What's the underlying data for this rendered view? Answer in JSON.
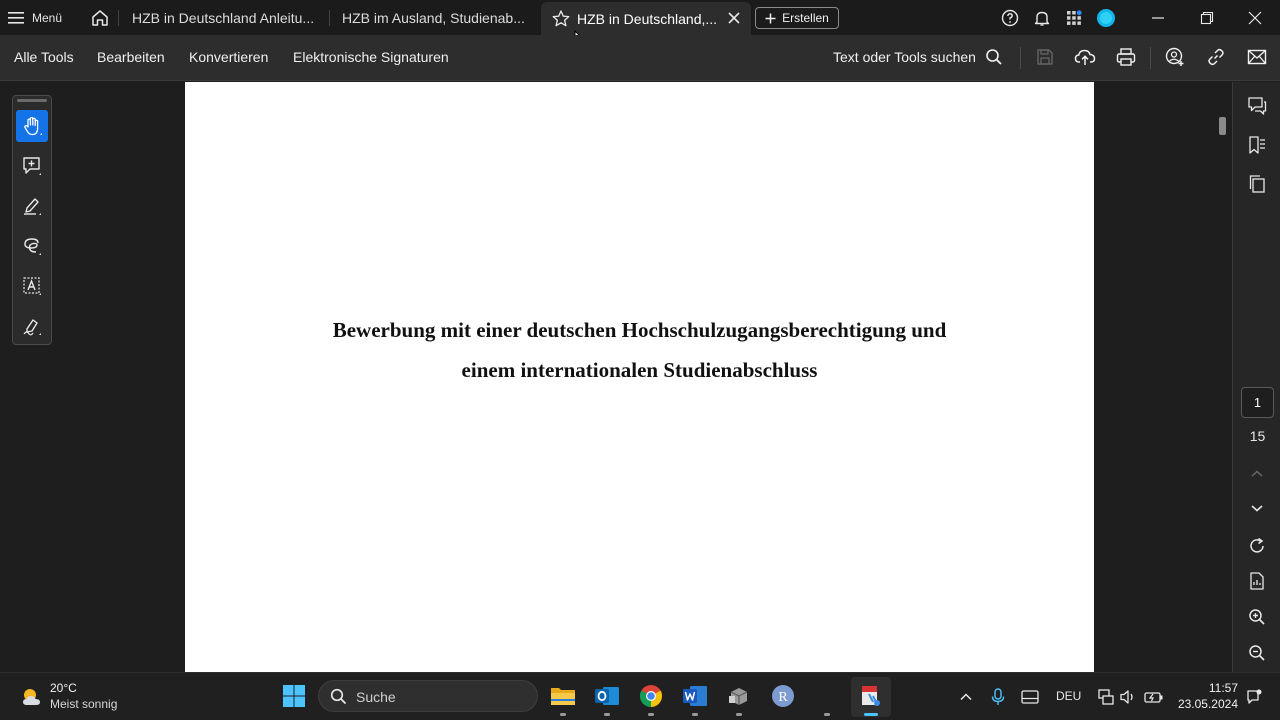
{
  "titlebar": {
    "menu_label": "Menü",
    "tabs": [
      {
        "label": "HZB in Deutschland Anleitu..."
      },
      {
        "label": "HZB im Ausland, Studienab..."
      },
      {
        "label": "HZB in Deutschland,..."
      }
    ],
    "create_label": "Erstellen"
  },
  "toolbar": {
    "items": [
      "Alle Tools",
      "Bearbeiten",
      "Konvertieren",
      "Elektronische Signaturen"
    ],
    "search_label": "Text oder Tools suchen"
  },
  "document": {
    "heading_line1": "Bewerbung mit einer deutschen Hochschulzugangsberechtigung und",
    "heading_line2": "einem internationalen Studienabschluss"
  },
  "navigation": {
    "current_page": "1",
    "total_pages": "15"
  },
  "taskbar": {
    "weather_temp": "20°C",
    "weather_desc": "Meist sonnig",
    "search_placeholder": "Suche",
    "language": "DEU",
    "time": "11:57",
    "date": "23.05.2024"
  },
  "colors": {
    "accent": "#1473e6",
    "page_bg": "#ffffff",
    "app_bg": "#1e1e1e"
  }
}
